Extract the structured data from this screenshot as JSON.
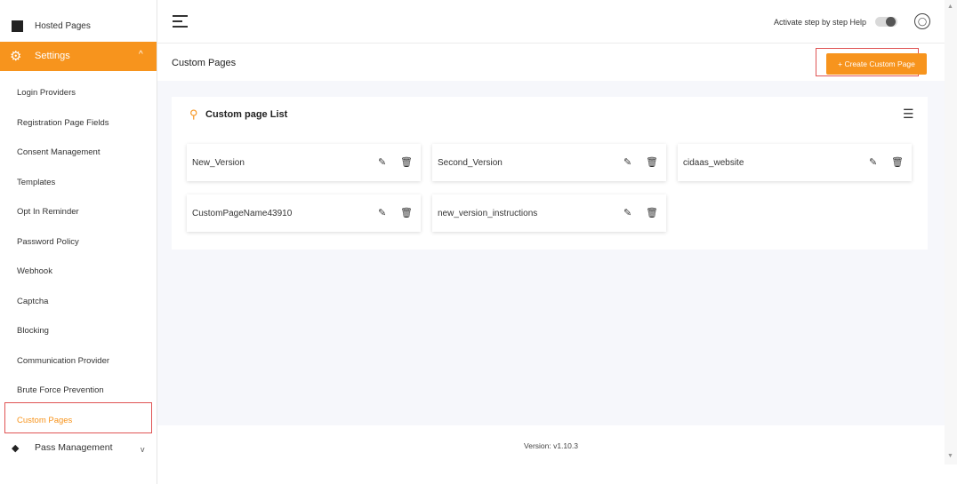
{
  "sidebar": {
    "top_item": "Hosted Pages",
    "settings_label": "Settings",
    "items": [
      "Login Providers",
      "Registration Page Fields",
      "Consent Management",
      "Templates",
      "Opt In Reminder",
      "Password Policy",
      "Webhook",
      "Captcha",
      "Blocking",
      "Communication Provider",
      "Brute Force Prevention",
      "Custom Pages"
    ],
    "pass_management": "Pass Management"
  },
  "topbar": {
    "help_label": "Activate step by step Help"
  },
  "header": {
    "title": "Custom Pages",
    "create_button": "+ Create Custom Page"
  },
  "list": {
    "title": "Custom page List",
    "pages": [
      "New_Version",
      "Second_Version",
      "cidaas_website",
      "CustomPageName43910",
      "new_version_instructions"
    ]
  },
  "footer": {
    "version": "Version: v1.10.3"
  },
  "colors": {
    "accent": "#f7941d",
    "highlight_border": "#e05454"
  }
}
